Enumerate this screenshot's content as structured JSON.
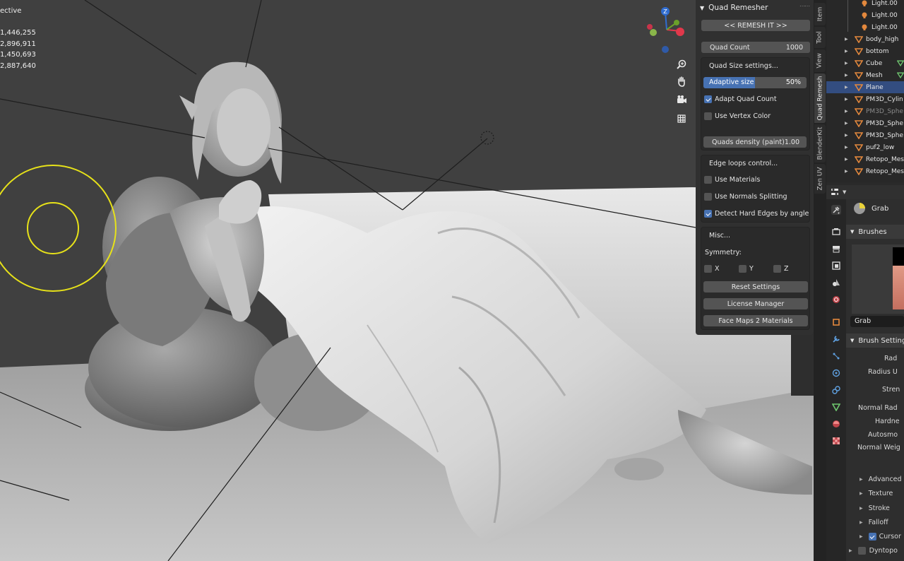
{
  "viewport": {
    "stats": [
      "ective",
      "",
      "1,446,255",
      "2,896,911",
      "1,450,693",
      "2,887,640"
    ],
    "gizmo": {
      "x_label": "",
      "y_label": "",
      "z_label": "Z"
    },
    "nav_buttons": [
      "zoom-icon",
      "hand-pan-icon",
      "camera-icon",
      "grid-icon"
    ],
    "colors": {
      "x": "#e0384b",
      "y": "#6ba12a",
      "z": "#2f6cd0",
      "brush": "#e7e219"
    }
  },
  "quad_remesher": {
    "title": "Quad Remesher",
    "remesh_button": "<< REMESH IT >>",
    "quad_count_label": "Quad Count",
    "quad_count_value": "1000",
    "size_settings_title": "Quad Size settings...",
    "adaptive_size_label": "Adaptive size",
    "adaptive_size_value": "50%",
    "adaptive_size_fraction": 0.5,
    "adapt_quad_count_label": "Adapt Quad Count",
    "use_vertex_color_label": "Use Vertex Color",
    "quads_density_label": "Quads density (paint)",
    "quads_density_value": "1.00",
    "edge_loops_title": "Edge loops control...",
    "use_materials_label": "Use Materials",
    "use_normals_splitting_label": "Use Normals Splitting",
    "detect_hard_edges_label": "Detect Hard Edges by angle",
    "misc_title": "Misc...",
    "symmetry_label": "Symmetry:",
    "sym_x": "X",
    "sym_y": "Y",
    "sym_z": "Z",
    "reset_settings": "Reset Settings",
    "license_manager": "License Manager",
    "face_maps": "Face Maps 2 Materials"
  },
  "vertical_tabs": [
    "Item",
    "Tool",
    "View",
    "Quad Remesh",
    "BlenderKit",
    "Zen UV"
  ],
  "outliner": {
    "rows": [
      {
        "name": "Light.00",
        "type": "light"
      },
      {
        "name": "Light.00",
        "type": "light"
      },
      {
        "name": "Light.00",
        "type": "light"
      },
      {
        "name": "body_high",
        "type": "mesh"
      },
      {
        "name": "bottom",
        "type": "mesh"
      },
      {
        "name": "Cube",
        "type": "mesh"
      },
      {
        "name": "Mesh",
        "type": "mesh"
      },
      {
        "name": "Plane",
        "type": "mesh"
      },
      {
        "name": "PM3D_Cylin",
        "type": "mesh"
      },
      {
        "name": "PM3D_Sphe",
        "type": "mesh"
      },
      {
        "name": "PM3D_Sphe",
        "type": "mesh"
      },
      {
        "name": "PM3D_Sphe",
        "type": "mesh"
      },
      {
        "name": "puf2_low",
        "type": "mesh"
      },
      {
        "name": "Retopo_Mes",
        "type": "mesh"
      },
      {
        "name": "Retopo_Mes",
        "type": "mesh"
      }
    ]
  },
  "properties": {
    "tool_name": "Grab",
    "brushes_header": "Brushes",
    "brush_name": "Grab",
    "brush_settings_header": "Brush Setting",
    "labels": [
      "Rad",
      "Radius U",
      "Stren",
      "Normal Rad",
      "Hardne",
      "Autosmo",
      "Normal Weig"
    ],
    "subsections": [
      "Advanced",
      "Texture",
      "Stroke",
      "Falloff",
      "Cursor"
    ],
    "dyntopo": "Dyntopo"
  }
}
